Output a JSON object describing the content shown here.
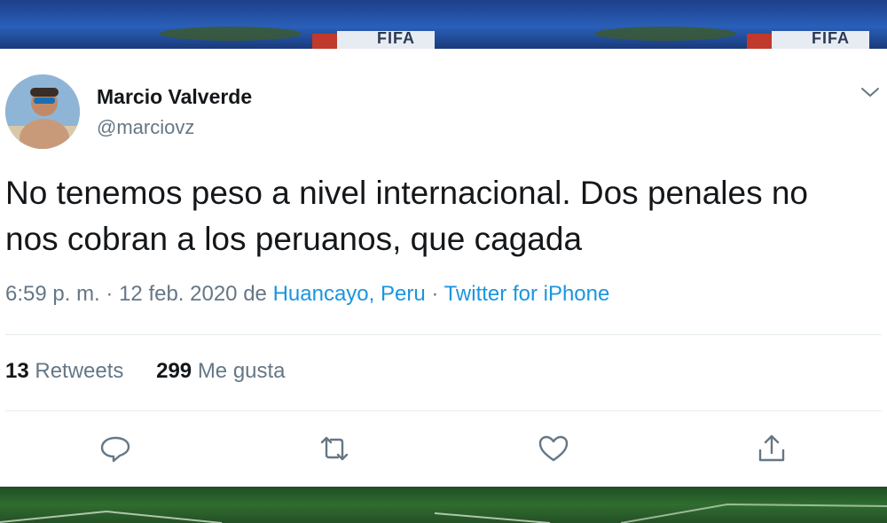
{
  "background": {
    "top_watermark": "FIFA"
  },
  "tweet": {
    "author_name": "Marcio Valverde",
    "author_handle": "@marciovz",
    "text_line1": "No tenemos peso a nivel internacional. Dos penales no",
    "text_line2": "nos cobran a los peruanos, que cagada",
    "time": "6:59 p. m.",
    "separator1": "·",
    "date": "12 feb. 2020",
    "location_prefix": "de",
    "location": "Huancayo, Peru",
    "separator2": "·",
    "source": "Twitter for iPhone",
    "retweets_count": "13",
    "retweets_label": "Retweets",
    "likes_count": "299",
    "likes_label": "Me gusta"
  },
  "colors": {
    "link": "#1b95e0",
    "muted": "#657786",
    "text": "#14171a"
  },
  "icons": {
    "caret": "chevron-down-icon",
    "reply": "reply-icon",
    "retweet": "retweet-icon",
    "like": "heart-icon",
    "share": "share-icon"
  }
}
